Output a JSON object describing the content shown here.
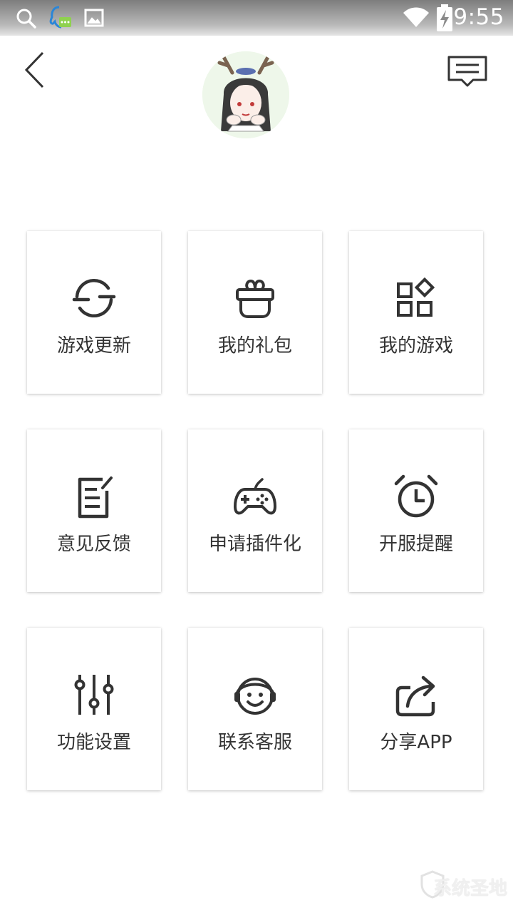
{
  "status_bar": {
    "time": "9:55",
    "icons": [
      "search-icon",
      "qq-chat-icon",
      "image-icon",
      "wifi-icon",
      "battery-charging-icon"
    ]
  },
  "header": {
    "back_icon": "chevron-left-icon",
    "message_icon": "message-icon",
    "avatar": "user-avatar"
  },
  "menu": [
    {
      "label": "游戏更新",
      "icon": "refresh-icon"
    },
    {
      "label": "我的礼包",
      "icon": "gift-icon"
    },
    {
      "label": "我的游戏",
      "icon": "apps-icon"
    },
    {
      "label": "意见反馈",
      "icon": "feedback-edit-icon"
    },
    {
      "label": "申请插件化",
      "icon": "gamepad-icon"
    },
    {
      "label": "开服提醒",
      "icon": "alarm-clock-icon"
    },
    {
      "label": "功能设置",
      "icon": "sliders-icon"
    },
    {
      "label": "联系客服",
      "icon": "headset-icon"
    },
    {
      "label": "分享APP",
      "icon": "share-icon"
    }
  ],
  "watermark": "系统圣地",
  "colors": {
    "icon_stroke": "#333333",
    "label": "#333333",
    "background": "#ffffff",
    "status_bar_top": "#7d7d7d"
  }
}
